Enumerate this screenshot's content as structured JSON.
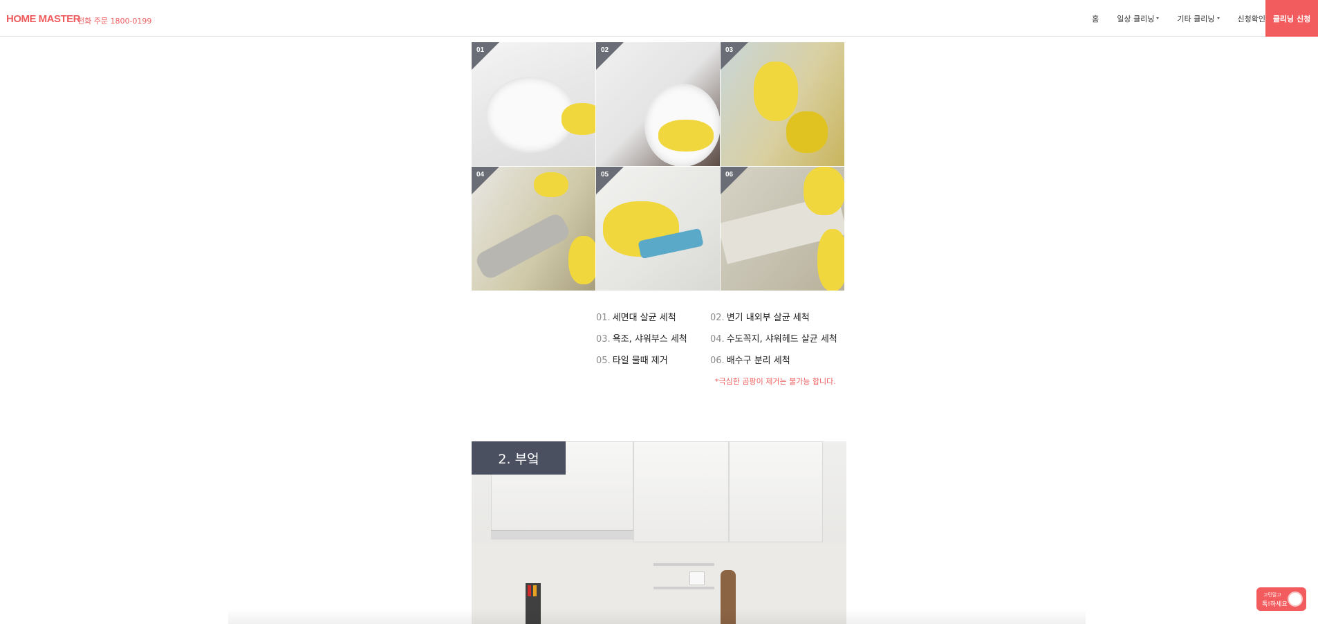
{
  "header": {
    "logo": "HOME MASTER",
    "phone": "전화 주문 1800-0199",
    "nav": [
      {
        "label": "홈",
        "dropdown": false
      },
      {
        "label": "일상 클리닝",
        "dropdown": true
      },
      {
        "label": "기타 클리닝",
        "dropdown": true
      },
      {
        "label": "신청확인",
        "dropdown": false
      }
    ],
    "apply_button": "클리닝 신청"
  },
  "bathroom": {
    "tiles": [
      "01",
      "02",
      "03",
      "04",
      "05",
      "06"
    ],
    "steps": [
      {
        "no": "01.",
        "text": "세면대 살균 세척"
      },
      {
        "no": "02.",
        "text": "변기 내외부 살균 세척"
      },
      {
        "no": "03.",
        "text": "욕조, 샤워부스 세척"
      },
      {
        "no": "04.",
        "text": "수도꼭지, 샤워헤드 살균 세척"
      },
      {
        "no": "05.",
        "text": "타일 물때 제거"
      },
      {
        "no": "06.",
        "text": "배수구 분리 세척"
      }
    ],
    "warning": "*극심한 곰팡이 제거는 불가능 합니다."
  },
  "kitchen": {
    "title": "2. 부엌"
  },
  "chat": {
    "line1": "고민말고",
    "line2": "톡!하세요"
  },
  "colors": {
    "accent": "#f25c5e",
    "badge": "#6a6d75",
    "title_bg": "#4b5060"
  }
}
